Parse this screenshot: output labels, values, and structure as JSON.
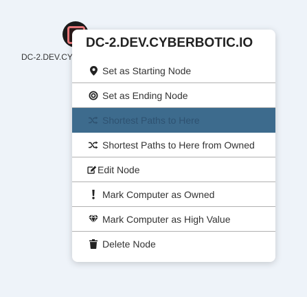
{
  "graph": {
    "node_label": "DC-2.DEV.CYBERBOTIC.IO"
  },
  "context_menu": {
    "title": "DC-2.DEV.CYBERBOTIC.IO",
    "items": [
      {
        "label": "Set as Starting Node",
        "icon": "map-marker-icon"
      },
      {
        "label": "Set as Ending Node",
        "icon": "bullseye-icon"
      },
      {
        "label": "Shortest Paths to Here",
        "icon": "random-icon",
        "highlighted": true
      },
      {
        "label": "Shortest Paths to Here from Owned",
        "icon": "random-icon"
      },
      {
        "label": "Edit Node",
        "icon": "edit-icon"
      },
      {
        "label": "Mark Computer as Owned",
        "icon": "exclamation-icon"
      },
      {
        "label": "Mark Computer as High Value",
        "icon": "gem-icon"
      },
      {
        "label": "Delete Node",
        "icon": "trash-icon"
      }
    ]
  },
  "colors": {
    "background": "#eef3f9",
    "highlight": "#3d6b8d",
    "node_accent": "#e8777a"
  }
}
